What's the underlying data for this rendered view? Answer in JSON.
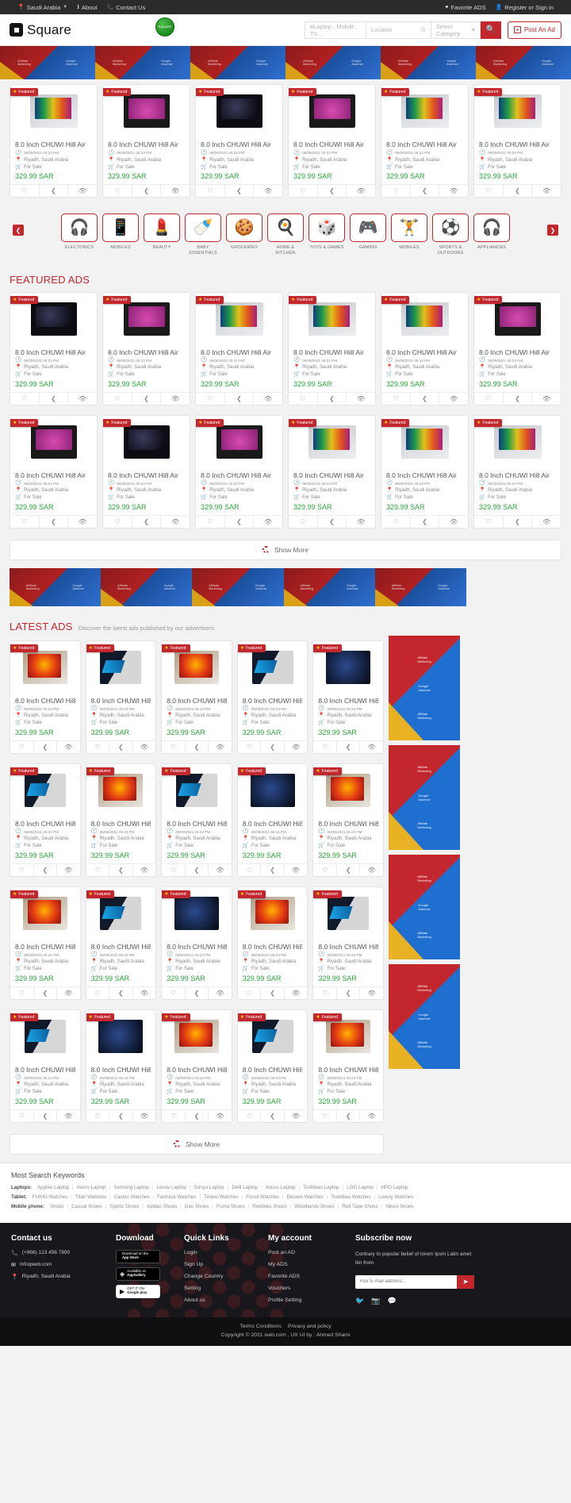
{
  "topbar": {
    "location": "Saudi Arabia",
    "about": "About",
    "contact": "Contact Us",
    "favorite": "Favorite ADS",
    "signin": "Register or Sign in"
  },
  "header": {
    "logo_text": "Square",
    "badge_text": "SQUARE",
    "search_placeholder": "#Laptop . Mobile . TV...",
    "location_placeholder": "Locaion",
    "category_placeholder": "Select Category",
    "post_ad": "Post An Ad"
  },
  "banner": {
    "line1": "Affiliate",
    "line2": "Marketing",
    "line3": "Google",
    "line4": "Adsense"
  },
  "card": {
    "featured": "Featured",
    "title": "8.0 Inch CHUWI Hi8 Air",
    "date": "06/09/2021 05:23 PM",
    "location": "Riyadh, Saudi Arabia",
    "status": "For Sale",
    "price": "329.99 SAR"
  },
  "categories": [
    {
      "label": "ELECTONICS",
      "icon": "🎧"
    },
    {
      "label": "MOBILES",
      "icon": "📱"
    },
    {
      "label": "BEAUTY",
      "icon": "💄"
    },
    {
      "label": "BABY ESSENTIALS",
      "icon": "🍼"
    },
    {
      "label": "GROCERIES",
      "icon": "🍪"
    },
    {
      "label": "HOME & KITCHEN",
      "icon": "🍳"
    },
    {
      "label": "TOYS & GAMES",
      "icon": "🎲"
    },
    {
      "label": "GAMING",
      "icon": "🎮"
    },
    {
      "label": "MOBILES",
      "icon": "🏋"
    },
    {
      "label": "SPORTS & OUTDOORS",
      "icon": "⚽"
    },
    {
      "label": "APPLIANCES",
      "icon": "🎧"
    }
  ],
  "featured_section": {
    "title": "FEATURED ADS",
    "show_more": "Show More"
  },
  "latest_section": {
    "title": "LATEST ADS",
    "subtitle": "Discover the latest ads published by our advertisers",
    "show_more": "Show More"
  },
  "keywords": {
    "heading": "Most Search Keywords",
    "rows": [
      {
        "label": "Laptops:",
        "items": [
          "Appleo Laptop",
          "Acero Laptop",
          "Samsing Laptop",
          "Lenov Laptop",
          "Sonyo Laptop",
          "Delli Laptop",
          "Asuso Laptop",
          "Toshibao Laptop",
          "LGG Laptop",
          "HPO Laptop"
        ]
      },
      {
        "label": "Tablet:",
        "items": [
          "FUKIO Watches",
          "Titan Watches",
          "Casioo Watches",
          "Fastrack Watches",
          "Timexi Watches",
          "Fossil Watches",
          "Dieselo Watches",
          "Toshibao Watches",
          "Luxury Watches"
        ]
      },
      {
        "label": "Mobile phone:",
        "items": [
          "Shoes",
          "Casual Shoes",
          "Sports Shoes",
          "Adidas Shoes",
          "Gas Shoes",
          "Puma Shoes",
          "Reeboks Shoes",
          "Woodlands Shoes",
          "Red Tape Shoes",
          "Nikeo Shoes"
        ]
      }
    ]
  },
  "footer": {
    "contact": {
      "heading": "Contact us",
      "phone": "(+966) 123 456 7890",
      "email": "Infoqweb.com",
      "address": "Riyadh, Saudi Arabia"
    },
    "download": {
      "heading": "Download",
      "buttons": [
        {
          "top": "Download on the",
          "name": "App Store"
        },
        {
          "top": "Available on",
          "name": "AppGallery"
        },
        {
          "top": "GET IT ON",
          "name": "Google play"
        }
      ]
    },
    "quick_links": {
      "heading": "Quick Links",
      "items": [
        "Login",
        "Sign Up",
        "Change Country",
        "Setting",
        "About us"
      ]
    },
    "my_account": {
      "heading": "My account",
      "items": [
        "Post an AD",
        "My ADS",
        "Favorite ADS",
        "Vouchers",
        "Profile Setting"
      ]
    },
    "subscribe": {
      "heading": "Subscribe now",
      "text": "Contrary to popular belief of lorem Ipsm Latin amet ltin from",
      "placeholder": "Your E-mail address..."
    }
  },
  "copyright": {
    "links": [
      "Terms Conditions",
      "Privacy and policy"
    ],
    "text": "Copyright © 2021 web.com , UX UI by : Ahmed Shami"
  },
  "colors": {
    "brand": "#c1272d",
    "price": "#2aa43a",
    "dark": "#18181c"
  }
}
